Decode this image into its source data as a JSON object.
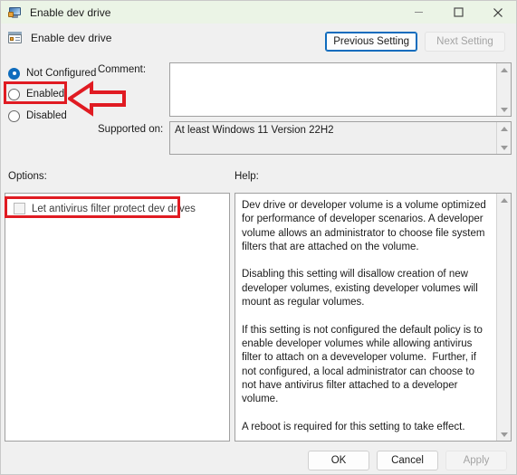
{
  "window": {
    "title": "Enable dev drive",
    "icon": "monitor-policy-icon",
    "controls": {
      "minimize": "minimize-icon",
      "maximize": "maximize-icon",
      "close": "close-icon"
    }
  },
  "header": {
    "title": "Enable dev drive",
    "icon": "policy-setting-icon",
    "previous_setting": "Previous Setting",
    "next_setting": "Next Setting"
  },
  "state": {
    "radio_selected": "Not Configured",
    "checkbox_checked": false,
    "apply_enabled": false
  },
  "radios": [
    {
      "label": "Not Configured",
      "selected": true
    },
    {
      "label": "Enabled",
      "selected": false
    },
    {
      "label": "Disabled",
      "selected": false
    }
  ],
  "fields": {
    "comment_label": "Comment:",
    "comment_value": "",
    "supported_label": "Supported on:",
    "supported_value": "At least Windows 11 Version 22H2"
  },
  "sections": {
    "options_label": "Options:",
    "help_label": "Help:"
  },
  "options": {
    "checkbox_label": "Let antivirus filter protect dev drives"
  },
  "help": {
    "text": "Dev drive or developer volume is a volume optimized for performance of developer scenarios. A developer volume allows an administrator to choose file system filters that are attached on the volume.\n\nDisabling this setting will disallow creation of new developer volumes, existing developer volumes will mount as regular volumes.\n\nIf this setting is not configured the default policy is to enable developer volumes while allowing antivirus filter to attach on a deveveloper volume.  Further, if not configured, a local administrator can choose to not have antivirus filter attached to a developer volume.\n\nA reboot is required for this setting to take effect."
  },
  "footer": {
    "ok": "OK",
    "cancel": "Cancel",
    "apply": "Apply"
  },
  "annotations": {
    "highlight_color": "#e01b22",
    "arrow": "left-pointing-arrow-annotation",
    "boxes": [
      "Enabled",
      "Let antivirus filter protect dev drives"
    ]
  },
  "colors": {
    "titlebar": "#ebf4e6",
    "dialog": "#f0f0f0",
    "accent": "#0f6cbd",
    "annotation": "#e01b22"
  }
}
